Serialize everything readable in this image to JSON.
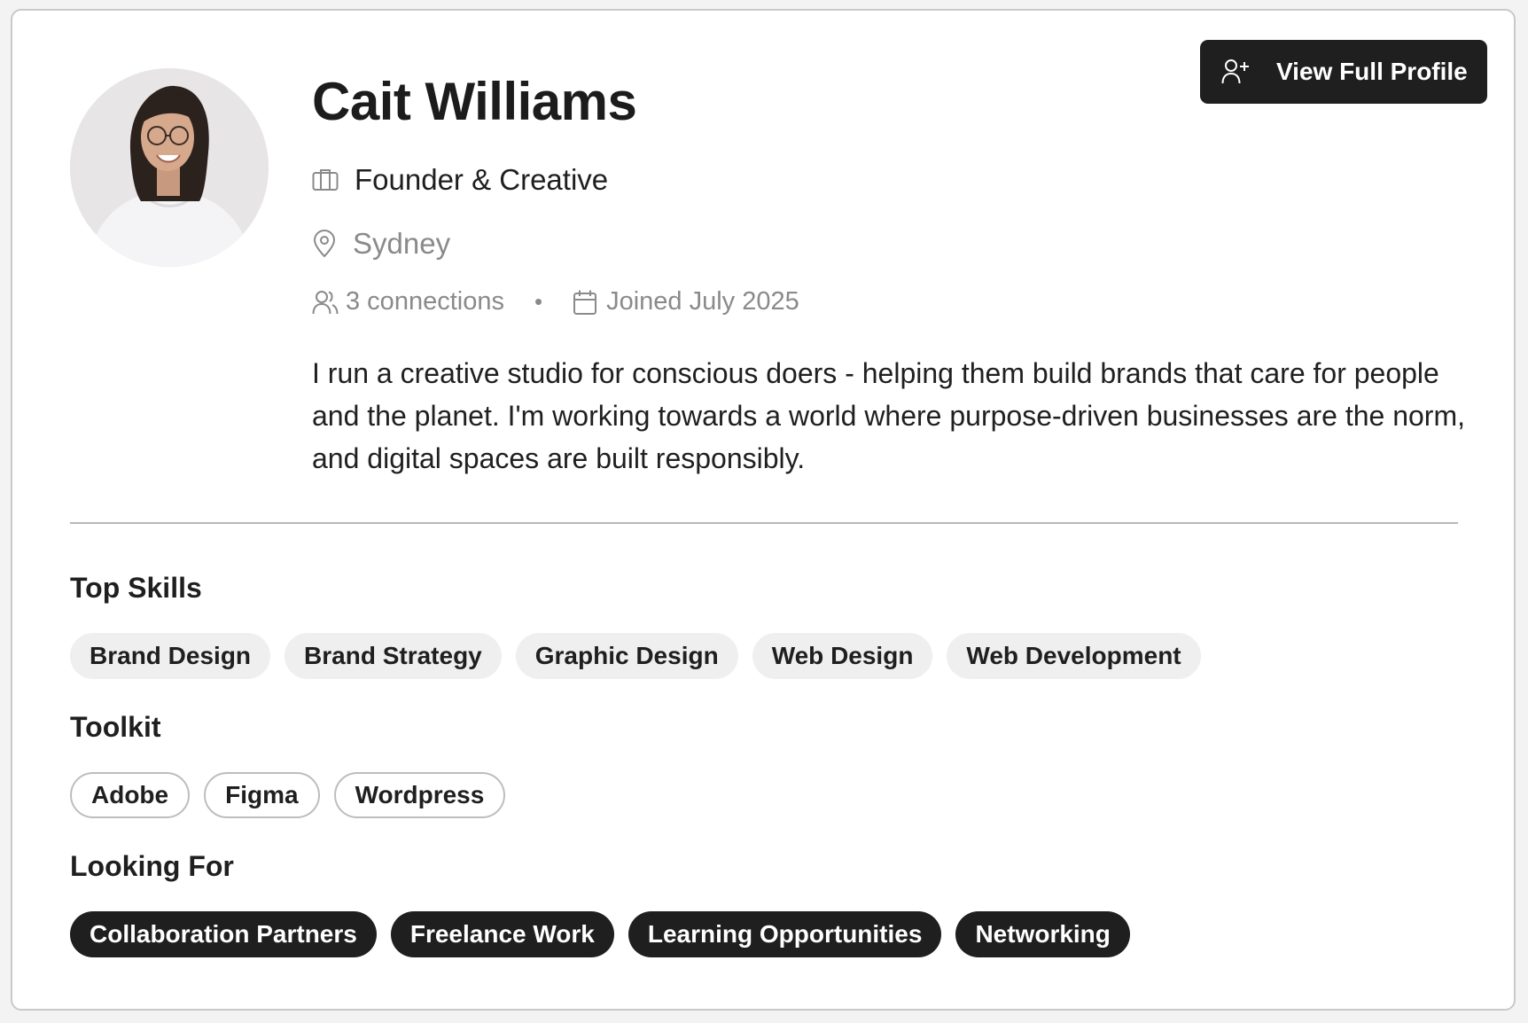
{
  "profile": {
    "name": "Cait Williams",
    "role": "Founder & Creative",
    "location": "Sydney",
    "connections": "3 connections",
    "separator": "•",
    "joined": "Joined July 2025",
    "bio": "I run a creative studio for conscious doers - helping them build brands that care for people and the planet. I'm working towards a world where purpose-driven businesses are the norm, and digital spaces are built responsibly."
  },
  "actions": {
    "view_full_profile": "View Full Profile"
  },
  "sections": {
    "top_skills": {
      "title": "Top Skills",
      "items": [
        "Brand Design",
        "Brand Strategy",
        "Graphic Design",
        "Web Design",
        "Web Development"
      ]
    },
    "toolkit": {
      "title": "Toolkit",
      "items": [
        "Adobe",
        "Figma",
        "Wordpress"
      ]
    },
    "looking_for": {
      "title": "Looking For",
      "items": [
        "Collaboration Partners",
        "Freelance Work",
        "Learning Opportunities",
        "Networking"
      ]
    }
  },
  "icons": {
    "role": "briefcase-icon",
    "location": "map-pin-icon",
    "connections": "users-icon",
    "joined": "calendar-icon",
    "button": "user-plus-icon"
  },
  "colors": {
    "primary_dark": "#1f1f1f",
    "muted_text": "#8a8a8a",
    "skill_chip_bg": "#efefef",
    "card_border": "#c9c9c9"
  }
}
